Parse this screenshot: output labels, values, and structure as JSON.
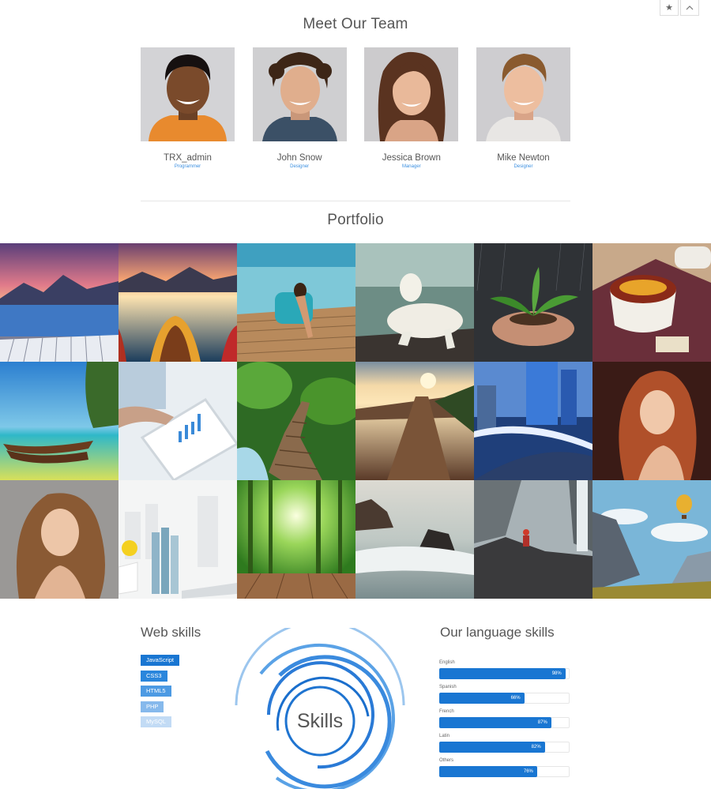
{
  "team": {
    "title": "Meet Our Team",
    "members": [
      {
        "name": "TRX_admin",
        "role": "Programmer"
      },
      {
        "name": "John Snow",
        "role": "Designer"
      },
      {
        "name": "Jessica Brown",
        "role": "Manager"
      },
      {
        "name": "Mike Newton",
        "role": "Designer"
      }
    ]
  },
  "portfolio": {
    "title": "Portfolio"
  },
  "web_skills": {
    "title": "Web skills",
    "tags": [
      {
        "label": "JavaScript",
        "color": "#1976d2"
      },
      {
        "label": "CSS3",
        "color": "#2a86dc"
      },
      {
        "label": "HTML5",
        "color": "#4c9ae3"
      },
      {
        "label": "PHP",
        "color": "#86b9ec"
      },
      {
        "label": "MySQL",
        "color": "#c2dbf5"
      }
    ],
    "circle_label": "Skills"
  },
  "language_skills": {
    "title": "Our language skills",
    "items": [
      {
        "label": "English",
        "value": 98,
        "text": "98%"
      },
      {
        "label": "Spanish",
        "value": 66,
        "text": "66%"
      },
      {
        "label": "French",
        "value": 87,
        "text": "87%"
      },
      {
        "label": "Latin",
        "value": 82,
        "text": "82%"
      },
      {
        "label": "Others",
        "value": 76,
        "text": "76%"
      }
    ],
    "color": "#1976d2"
  }
}
